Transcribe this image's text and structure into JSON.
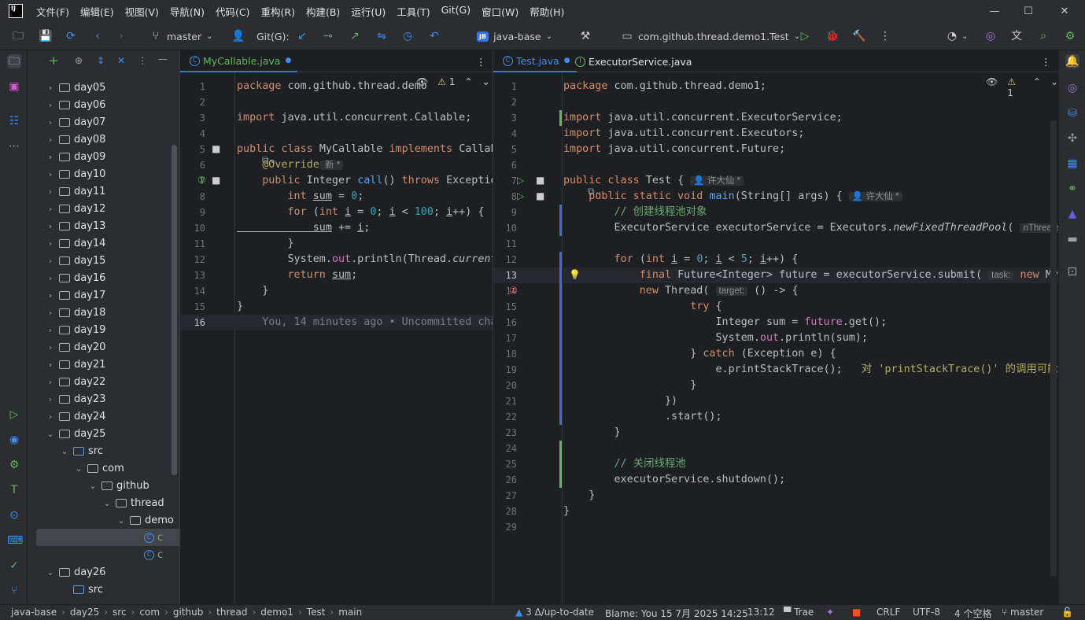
{
  "menu": [
    "文件(F)",
    "编辑(E)",
    "视图(V)",
    "导航(N)",
    "代码(C)",
    "重构(R)",
    "构建(B)",
    "运行(U)",
    "工具(T)",
    "Git(G)",
    "窗口(W)",
    "帮助(H)"
  ],
  "toolbar": {
    "branch": "master",
    "git_label": "Git(G):",
    "project": "java-base",
    "project_badge": "JB",
    "run_config": "com.github.thread.demo1.Test"
  },
  "tree": [
    {
      "label": "day05",
      "indent": 1,
      "type": "folder",
      "exp": "closed"
    },
    {
      "label": "day06",
      "indent": 1,
      "type": "folder",
      "exp": "closed"
    },
    {
      "label": "day07",
      "indent": 1,
      "type": "folder",
      "exp": "closed"
    },
    {
      "label": "day08",
      "indent": 1,
      "type": "folder",
      "exp": "closed"
    },
    {
      "label": "day09",
      "indent": 1,
      "type": "folder",
      "exp": "closed"
    },
    {
      "label": "day10",
      "indent": 1,
      "type": "folder",
      "exp": "closed"
    },
    {
      "label": "day11",
      "indent": 1,
      "type": "folder",
      "exp": "closed"
    },
    {
      "label": "day12",
      "indent": 1,
      "type": "folder",
      "exp": "closed"
    },
    {
      "label": "day13",
      "indent": 1,
      "type": "folder",
      "exp": "closed"
    },
    {
      "label": "day14",
      "indent": 1,
      "type": "folder",
      "exp": "closed"
    },
    {
      "label": "day15",
      "indent": 1,
      "type": "folder",
      "exp": "closed"
    },
    {
      "label": "day16",
      "indent": 1,
      "type": "folder",
      "exp": "closed"
    },
    {
      "label": "day17",
      "indent": 1,
      "type": "folder",
      "exp": "closed"
    },
    {
      "label": "day18",
      "indent": 1,
      "type": "folder",
      "exp": "closed"
    },
    {
      "label": "day19",
      "indent": 1,
      "type": "folder",
      "exp": "closed"
    },
    {
      "label": "day20",
      "indent": 1,
      "type": "folder",
      "exp": "closed"
    },
    {
      "label": "day21",
      "indent": 1,
      "type": "folder",
      "exp": "closed"
    },
    {
      "label": "day22",
      "indent": 1,
      "type": "folder",
      "exp": "closed"
    },
    {
      "label": "day23",
      "indent": 1,
      "type": "folder",
      "exp": "closed"
    },
    {
      "label": "day24",
      "indent": 1,
      "type": "folder",
      "exp": "closed"
    },
    {
      "label": "day25",
      "indent": 1,
      "type": "folder",
      "exp": "open"
    },
    {
      "label": "src",
      "indent": 2,
      "type": "srcfolder",
      "exp": "open"
    },
    {
      "label": "com",
      "indent": 3,
      "type": "folder",
      "exp": "open"
    },
    {
      "label": "github",
      "indent": 4,
      "type": "folder",
      "exp": "open"
    },
    {
      "label": "thread",
      "indent": 5,
      "type": "folder",
      "exp": "open"
    },
    {
      "label": "demo",
      "indent": 6,
      "type": "folder",
      "exp": "open"
    },
    {
      "label": "c",
      "indent": 7,
      "type": "class",
      "exp": "none"
    },
    {
      "label": "c",
      "indent": 7,
      "type": "class",
      "exp": "none"
    },
    {
      "label": "day26",
      "indent": 1,
      "type": "folder",
      "exp": "open"
    },
    {
      "label": "src",
      "indent": 2,
      "type": "srcfolder",
      "exp": "none"
    }
  ],
  "left_editor": {
    "tabs": [
      {
        "label": "MyCallable.java",
        "active": true
      }
    ],
    "inspect": "1",
    "lines": [
      [
        [
          "kw",
          "package "
        ],
        [
          "t",
          "com.github.thread.demo"
        ]
      ],
      [],
      [
        [
          "kw",
          "import "
        ],
        [
          "t",
          "java.util.concurrent.Callable;"
        ]
      ],
      [],
      [
        [
          "kw",
          "public class "
        ],
        [
          "t",
          "MyCallable "
        ],
        [
          "kw",
          "implements "
        ],
        [
          "t",
          "Callab"
        ]
      ],
      [
        [
          "an",
          "    @Override"
        ],
        [
          "hint",
          " 新 *"
        ]
      ],
      [
        [
          "kw",
          "    public "
        ],
        [
          "t",
          "Integer "
        ],
        [
          "fn",
          "call"
        ],
        [
          "t",
          "() "
        ],
        [
          "kw",
          "throws "
        ],
        [
          "t",
          "Exceptio"
        ]
      ],
      [
        [
          "kw",
          "        int "
        ],
        [
          "var",
          "sum"
        ],
        [
          "t",
          " = "
        ],
        [
          "num",
          "0"
        ],
        [
          "t",
          ";"
        ]
      ],
      [
        [
          "kw",
          "        for "
        ],
        [
          "t",
          "("
        ],
        [
          "kw",
          "int "
        ],
        [
          "var",
          "i"
        ],
        [
          "t",
          " = "
        ],
        [
          "num",
          "0"
        ],
        [
          "t",
          "; "
        ],
        [
          "var",
          "i"
        ],
        [
          "t",
          " < "
        ],
        [
          "num",
          "100"
        ],
        [
          "t",
          "; "
        ],
        [
          "var",
          "i"
        ],
        [
          "t",
          "++) {"
        ]
      ],
      [
        [
          "var",
          "            sum"
        ],
        [
          "t",
          " += "
        ],
        [
          "var",
          "i"
        ],
        [
          "t",
          ";"
        ]
      ],
      [
        [
          "t",
          "        }"
        ]
      ],
      [
        [
          "t",
          "        System."
        ],
        [
          "fld",
          "out"
        ],
        [
          "t",
          ".println(Thread."
        ],
        [
          "it",
          "current"
        ]
      ],
      [
        [
          "kw",
          "        return "
        ],
        [
          "var",
          "sum"
        ],
        [
          "t",
          ";"
        ]
      ],
      [
        [
          "t",
          "    }"
        ]
      ],
      [
        [
          "t",
          "}"
        ]
      ],
      [
        [
          "cm",
          "    You, 14 minutes ago • Uncommitted char"
        ]
      ]
    ]
  },
  "right_editor": {
    "tabs": [
      {
        "label": "Test.java",
        "active": true
      },
      {
        "label": "ExecutorService.java",
        "active": false
      }
    ],
    "inspect": "1",
    "author_hint": "许大仙 *",
    "lines": [
      [
        [
          "kw",
          "package "
        ],
        [
          "t",
          "com.github.thread.demo1;"
        ]
      ],
      [],
      [
        [
          "kw",
          "import "
        ],
        [
          "t",
          "java.util.concurrent.ExecutorService;"
        ]
      ],
      [
        [
          "kw",
          "import "
        ],
        [
          "t",
          "java.util.concurrent.Executors;"
        ]
      ],
      [
        [
          "kw",
          "import "
        ],
        [
          "t",
          "java.util.concurrent.Future;"
        ]
      ],
      [],
      [
        [
          "kw",
          "public class "
        ],
        [
          "t",
          "Test { "
        ],
        [
          "hint",
          "👤 许大仙 *"
        ]
      ],
      [
        [
          "kw",
          "    public static void "
        ],
        [
          "fn",
          "main"
        ],
        [
          "t",
          "(String[] args) { "
        ],
        [
          "hint",
          "👤 许大仙 *"
        ]
      ],
      [
        [
          "cmcn",
          "        // 创建线程池对象"
        ]
      ],
      [
        [
          "t",
          "        ExecutorService executorService = Executors."
        ],
        [
          "it",
          "newFixedThreadPool"
        ],
        [
          "t",
          "( "
        ],
        [
          "hint",
          "nThreads"
        ]
      ],
      [],
      [
        [
          "kw",
          "        for "
        ],
        [
          "t",
          "("
        ],
        [
          "kw",
          "int "
        ],
        [
          "var",
          "i"
        ],
        [
          "t",
          " = "
        ],
        [
          "num",
          "0"
        ],
        [
          "t",
          "; "
        ],
        [
          "var",
          "i"
        ],
        [
          "t",
          " < "
        ],
        [
          "num",
          "5"
        ],
        [
          "t",
          "; "
        ],
        [
          "var",
          "i"
        ],
        [
          "t",
          "++) {"
        ]
      ],
      [
        [
          "kw",
          "            final "
        ],
        [
          "t",
          "Future<Integer> future = executorService.submit( "
        ],
        [
          "hint",
          "task:"
        ],
        [
          "kw",
          " new "
        ],
        [
          "t",
          "MyCa"
        ]
      ],
      [
        [
          "kw",
          "            new "
        ],
        [
          "t",
          "Thread( "
        ],
        [
          "hint",
          "target:"
        ],
        [
          "t",
          " () -> {"
        ]
      ],
      [
        [
          "kw",
          "                    try "
        ],
        [
          "t",
          "{"
        ]
      ],
      [
        [
          "t",
          "                        Integer sum = "
        ],
        [
          "fld",
          "future"
        ],
        [
          "t",
          ".get();"
        ]
      ],
      [
        [
          "t",
          "                        System."
        ],
        [
          "fld",
          "out"
        ],
        [
          "t",
          ".println(sum);"
        ]
      ],
      [
        [
          "t",
          "                    } "
        ],
        [
          "kw",
          "catch "
        ],
        [
          "t",
          "(Exception e) {"
        ]
      ],
      [
        [
          "t",
          "                        e.printStackTrace(); "
        ],
        [
          "an",
          "  对 'printStackTrace()' 的调用可能应"
        ]
      ],
      [
        [
          "t",
          "                    }"
        ]
      ],
      [
        [
          "t",
          "                })"
        ]
      ],
      [
        [
          "t",
          "                .start();"
        ]
      ],
      [
        [
          "t",
          "        }"
        ]
      ],
      [],
      [
        [
          "cmcn",
          "        // 关闭线程池"
        ]
      ],
      [
        [
          "t",
          "        executorService.shutdown();"
        ]
      ],
      [
        [
          "t",
          "    }"
        ]
      ],
      [
        [
          "t",
          "}"
        ]
      ],
      []
    ]
  },
  "status": {
    "path": [
      "java-base",
      "day25",
      "src",
      "com",
      "github",
      "thread",
      "demo1",
      "Test",
      "main"
    ],
    "vcs_status": "3 Δ/up-to-date",
    "blame": "Blame: You 15 7月 2025 14:25",
    "pos": "13:12",
    "trae": "Trae",
    "crlf": "CRLF",
    "enc": "UTF-8",
    "indent": "4 个空格",
    "branch": "master"
  }
}
